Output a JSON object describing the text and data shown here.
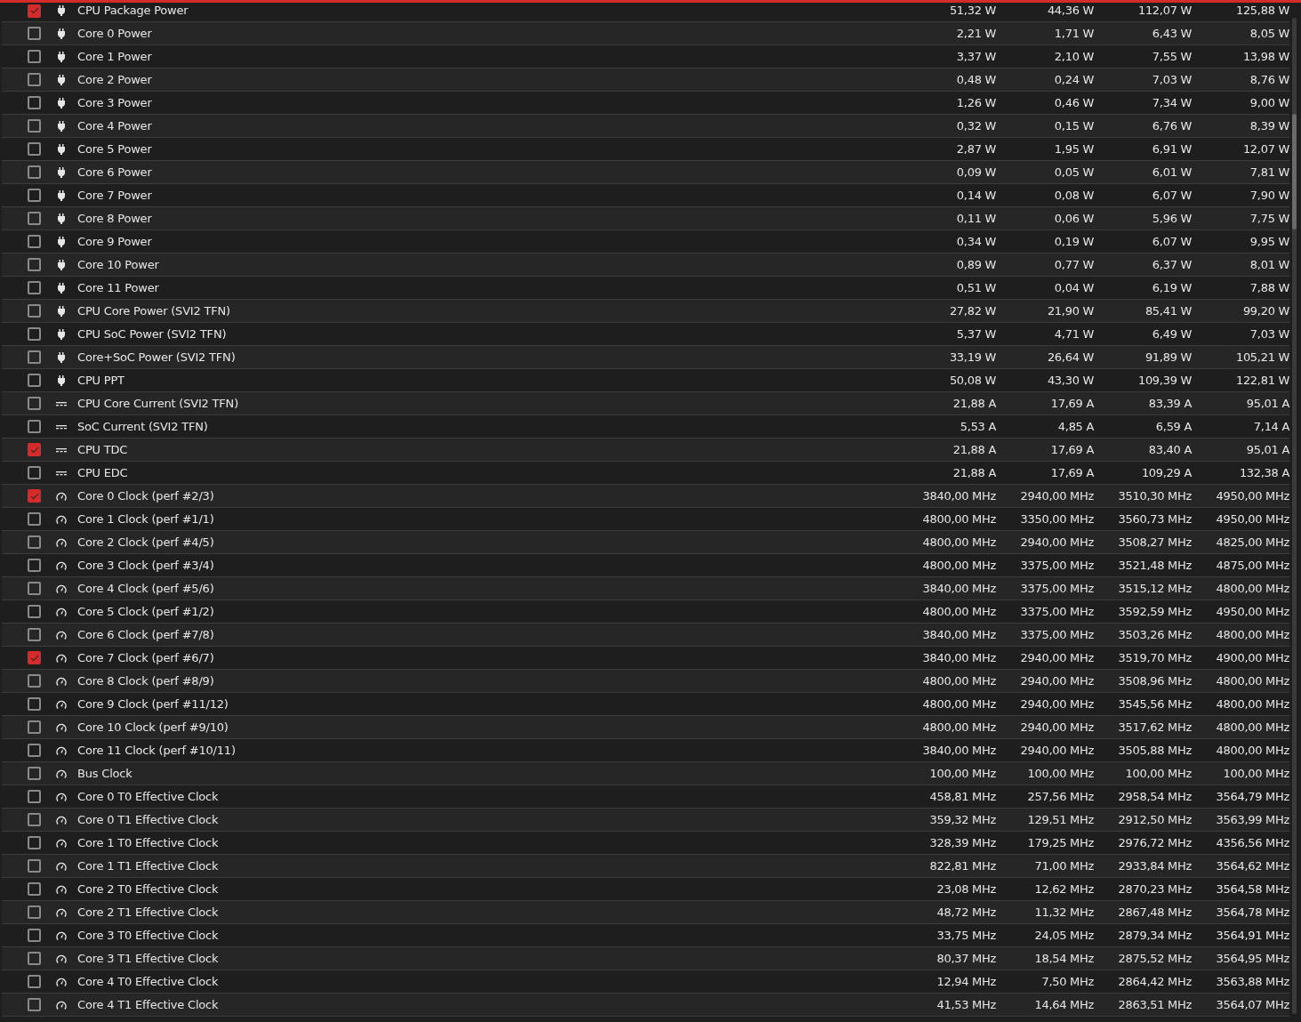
{
  "rows": [
    {
      "kind": "power",
      "checked": true,
      "label": "CPU Package Power",
      "values": [
        "51,32 W",
        "44,36 W",
        "112,07 W",
        "125,88 W"
      ]
    },
    {
      "kind": "power",
      "checked": false,
      "label": "Core 0 Power",
      "values": [
        "2,21 W",
        "1,71 W",
        "6,43 W",
        "8,05 W"
      ]
    },
    {
      "kind": "power",
      "checked": false,
      "label": "Core 1 Power",
      "values": [
        "3,37 W",
        "2,10 W",
        "7,55 W",
        "13,98 W"
      ]
    },
    {
      "kind": "power",
      "checked": false,
      "label": "Core 2 Power",
      "values": [
        "0,48 W",
        "0,24 W",
        "7,03 W",
        "8,76 W"
      ]
    },
    {
      "kind": "power",
      "checked": false,
      "label": "Core 3 Power",
      "values": [
        "1,26 W",
        "0,46 W",
        "7,34 W",
        "9,00 W"
      ]
    },
    {
      "kind": "power",
      "checked": false,
      "label": "Core 4 Power",
      "values": [
        "0,32 W",
        "0,15 W",
        "6,76 W",
        "8,39 W"
      ]
    },
    {
      "kind": "power",
      "checked": false,
      "label": "Core 5 Power",
      "values": [
        "2,87 W",
        "1,95 W",
        "6,91 W",
        "12,07 W"
      ]
    },
    {
      "kind": "power",
      "checked": false,
      "label": "Core 6 Power",
      "values": [
        "0,09 W",
        "0,05 W",
        "6,01 W",
        "7,81 W"
      ]
    },
    {
      "kind": "power",
      "checked": false,
      "label": "Core 7 Power",
      "values": [
        "0,14 W",
        "0,08 W",
        "6,07 W",
        "7,90 W"
      ]
    },
    {
      "kind": "power",
      "checked": false,
      "label": "Core 8 Power",
      "values": [
        "0,11 W",
        "0,06 W",
        "5,96 W",
        "7,75 W"
      ]
    },
    {
      "kind": "power",
      "checked": false,
      "label": "Core 9 Power",
      "values": [
        "0,34 W",
        "0,19 W",
        "6,07 W",
        "9,95 W"
      ]
    },
    {
      "kind": "power",
      "checked": false,
      "label": "Core 10 Power",
      "values": [
        "0,89 W",
        "0,77 W",
        "6,37 W",
        "8,01 W"
      ]
    },
    {
      "kind": "power",
      "checked": false,
      "label": "Core 11 Power",
      "values": [
        "0,51 W",
        "0,04 W",
        "6,19 W",
        "7,88 W"
      ]
    },
    {
      "kind": "power",
      "checked": false,
      "label": "CPU Core Power (SVI2 TFN)",
      "values": [
        "27,82 W",
        "21,90 W",
        "85,41 W",
        "99,20 W"
      ]
    },
    {
      "kind": "power",
      "checked": false,
      "label": "CPU SoC Power (SVI2 TFN)",
      "values": [
        "5,37 W",
        "4,71 W",
        "6,49 W",
        "7,03 W"
      ]
    },
    {
      "kind": "power",
      "checked": false,
      "label": "Core+SoC Power (SVI2 TFN)",
      "values": [
        "33,19 W",
        "26,64 W",
        "91,89 W",
        "105,21 W"
      ]
    },
    {
      "kind": "power",
      "checked": false,
      "label": "CPU PPT",
      "values": [
        "50,08 W",
        "43,30 W",
        "109,39 W",
        "122,81 W"
      ]
    },
    {
      "kind": "current",
      "checked": false,
      "label": "CPU Core Current (SVI2 TFN)",
      "values": [
        "21,88 A",
        "17,69 A",
        "83,39 A",
        "95,01 A"
      ]
    },
    {
      "kind": "current",
      "checked": false,
      "label": "SoC Current (SVI2 TFN)",
      "values": [
        "5,53 A",
        "4,85 A",
        "6,59 A",
        "7,14 A"
      ]
    },
    {
      "kind": "current",
      "checked": true,
      "label": "CPU TDC",
      "values": [
        "21,88 A",
        "17,69 A",
        "83,40 A",
        "95,01 A"
      ]
    },
    {
      "kind": "current",
      "checked": false,
      "label": "CPU EDC",
      "values": [
        "21,88 A",
        "17,69 A",
        "109,29 A",
        "132,38 A"
      ]
    },
    {
      "kind": "clock",
      "checked": true,
      "label": "Core 0 Clock (perf #2/3)",
      "values": [
        "3840,00 MHz",
        "2940,00 MHz",
        "3510,30 MHz",
        "4950,00 MHz"
      ]
    },
    {
      "kind": "clock",
      "checked": false,
      "label": "Core 1 Clock (perf #1/1)",
      "values": [
        "4800,00 MHz",
        "3350,00 MHz",
        "3560,73 MHz",
        "4950,00 MHz"
      ]
    },
    {
      "kind": "clock",
      "checked": false,
      "label": "Core 2 Clock (perf #4/5)",
      "values": [
        "4800,00 MHz",
        "2940,00 MHz",
        "3508,27 MHz",
        "4825,00 MHz"
      ]
    },
    {
      "kind": "clock",
      "checked": false,
      "label": "Core 3 Clock (perf #3/4)",
      "values": [
        "4800,00 MHz",
        "3375,00 MHz",
        "3521,48 MHz",
        "4875,00 MHz"
      ]
    },
    {
      "kind": "clock",
      "checked": false,
      "label": "Core 4 Clock (perf #5/6)",
      "values": [
        "3840,00 MHz",
        "3375,00 MHz",
        "3515,12 MHz",
        "4800,00 MHz"
      ]
    },
    {
      "kind": "clock",
      "checked": false,
      "label": "Core 5 Clock (perf #1/2)",
      "values": [
        "4800,00 MHz",
        "3375,00 MHz",
        "3592,59 MHz",
        "4950,00 MHz"
      ]
    },
    {
      "kind": "clock",
      "checked": false,
      "label": "Core 6 Clock (perf #7/8)",
      "values": [
        "3840,00 MHz",
        "3375,00 MHz",
        "3503,26 MHz",
        "4800,00 MHz"
      ]
    },
    {
      "kind": "clock",
      "checked": true,
      "label": "Core 7 Clock (perf #6/7)",
      "values": [
        "3840,00 MHz",
        "2940,00 MHz",
        "3519,70 MHz",
        "4900,00 MHz"
      ]
    },
    {
      "kind": "clock",
      "checked": false,
      "label": "Core 8 Clock (perf #8/9)",
      "values": [
        "4800,00 MHz",
        "2940,00 MHz",
        "3508,96 MHz",
        "4800,00 MHz"
      ]
    },
    {
      "kind": "clock",
      "checked": false,
      "label": "Core 9 Clock (perf #11/12)",
      "values": [
        "4800,00 MHz",
        "2940,00 MHz",
        "3545,56 MHz",
        "4800,00 MHz"
      ]
    },
    {
      "kind": "clock",
      "checked": false,
      "label": "Core 10 Clock (perf #9/10)",
      "values": [
        "4800,00 MHz",
        "2940,00 MHz",
        "3517,62 MHz",
        "4800,00 MHz"
      ]
    },
    {
      "kind": "clock",
      "checked": false,
      "label": "Core 11 Clock (perf #10/11)",
      "values": [
        "3840,00 MHz",
        "2940,00 MHz",
        "3505,88 MHz",
        "4800,00 MHz"
      ]
    },
    {
      "kind": "clock",
      "checked": false,
      "label": "Bus Clock",
      "values": [
        "100,00 MHz",
        "100,00 MHz",
        "100,00 MHz",
        "100,00 MHz"
      ]
    },
    {
      "kind": "clock",
      "checked": false,
      "label": "Core 0 T0 Effective Clock",
      "values": [
        "458,81 MHz",
        "257,56 MHz",
        "2958,54 MHz",
        "3564,79 MHz"
      ]
    },
    {
      "kind": "clock",
      "checked": false,
      "label": "Core 0 T1 Effective Clock",
      "values": [
        "359,32 MHz",
        "129,51 MHz",
        "2912,50 MHz",
        "3563,99 MHz"
      ]
    },
    {
      "kind": "clock",
      "checked": false,
      "label": "Core 1 T0 Effective Clock",
      "values": [
        "328,39 MHz",
        "179,25 MHz",
        "2976,72 MHz",
        "4356,56 MHz"
      ]
    },
    {
      "kind": "clock",
      "checked": false,
      "label": "Core 1 T1 Effective Clock",
      "values": [
        "822,81 MHz",
        "71,00 MHz",
        "2933,84 MHz",
        "3564,62 MHz"
      ]
    },
    {
      "kind": "clock",
      "checked": false,
      "label": "Core 2 T0 Effective Clock",
      "values": [
        "23,08 MHz",
        "12,62 MHz",
        "2870,23 MHz",
        "3564,58 MHz"
      ]
    },
    {
      "kind": "clock",
      "checked": false,
      "label": "Core 2 T1 Effective Clock",
      "values": [
        "48,72 MHz",
        "11,32 MHz",
        "2867,48 MHz",
        "3564,78 MHz"
      ]
    },
    {
      "kind": "clock",
      "checked": false,
      "label": "Core 3 T0 Effective Clock",
      "values": [
        "33,75 MHz",
        "24,05 MHz",
        "2879,34 MHz",
        "3564,91 MHz"
      ]
    },
    {
      "kind": "clock",
      "checked": false,
      "label": "Core 3 T1 Effective Clock",
      "values": [
        "80,37 MHz",
        "18,54 MHz",
        "2875,52 MHz",
        "3564,95 MHz"
      ]
    },
    {
      "kind": "clock",
      "checked": false,
      "label": "Core 4 T0 Effective Clock",
      "values": [
        "12,94 MHz",
        "7,50 MHz",
        "2864,42 MHz",
        "3563,88 MHz"
      ]
    },
    {
      "kind": "clock",
      "checked": false,
      "label": "Core 4 T1 Effective Clock",
      "values": [
        "41,53 MHz",
        "14,64 MHz",
        "2863,51 MHz",
        "3564,07 MHz"
      ]
    }
  ]
}
